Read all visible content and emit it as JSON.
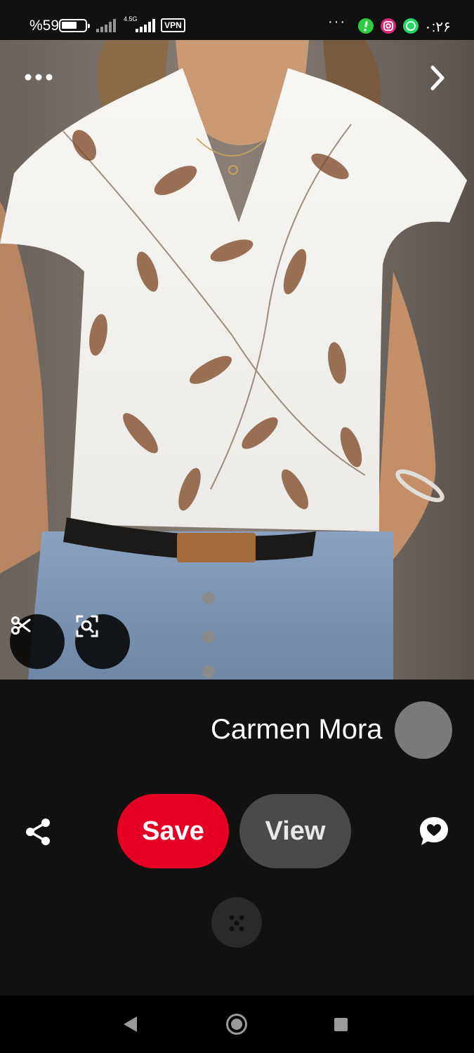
{
  "status_bar": {
    "battery_percent": "%59",
    "battery_level": 0.59,
    "network_type": "4.5G",
    "vpn_label": "VPN",
    "overflow_label": "···",
    "time": "۰:۲۶",
    "apps": [
      "green-exclamation-icon",
      "instagram-icon",
      "whatsapp-icon"
    ]
  },
  "photo": {
    "overlay_actions": [
      "scissors-icon",
      "visual-search-icon"
    ],
    "top_actions": [
      "more-options-icon",
      "next-icon"
    ]
  },
  "pin": {
    "author_name": "Carmen Mora"
  },
  "actions": {
    "save_label": "Save",
    "view_label": "View",
    "share_icon": "share-icon",
    "comment_icon": "heart-chat-icon"
  },
  "colors": {
    "save": "#e60023",
    "view": "#4a4a4a",
    "background": "#111111"
  }
}
